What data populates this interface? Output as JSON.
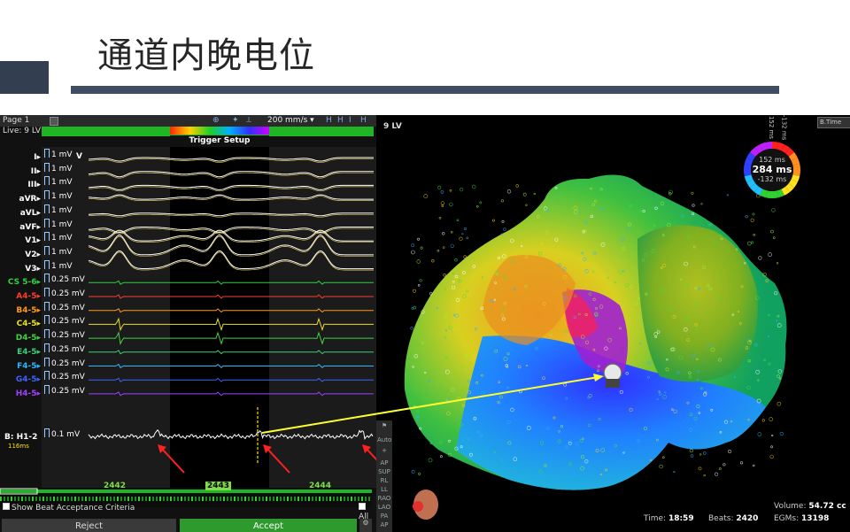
{
  "slide": {
    "title": "通道内晚电位"
  },
  "ep": {
    "page": "Page 1",
    "live": "Live: 9 LV",
    "speed": "200 mm/s",
    "trigger": "Trigger Setup",
    "leads": [
      {
        "name": "I",
        "scale": "1 mV",
        "color": "#ffffff"
      },
      {
        "name": "II",
        "scale": "1 mV",
        "color": "#ffffff"
      },
      {
        "name": "III",
        "scale": "1 mV",
        "color": "#ffffff"
      },
      {
        "name": "aVR",
        "scale": "1 mV",
        "color": "#ffffff"
      },
      {
        "name": "aVL",
        "scale": "1 mV",
        "color": "#ffffff"
      },
      {
        "name": "aVF",
        "scale": "1 mV",
        "color": "#ffffff"
      },
      {
        "name": "V1",
        "scale": "1 mV",
        "color": "#ffffff"
      },
      {
        "name": "V2",
        "scale": "1 mV",
        "color": "#ffffff"
      },
      {
        "name": "V3",
        "scale": "1 mV",
        "color": "#ffffff"
      },
      {
        "name": "CS 5-6",
        "scale": "0.25 mV",
        "color": "#32d040"
      },
      {
        "name": "A4-5",
        "scale": "0.25 mV",
        "color": "#ff3b30"
      },
      {
        "name": "B4-5",
        "scale": "0.25 mV",
        "color": "#ff9a1a"
      },
      {
        "name": "C4-5",
        "scale": "0.25 mV",
        "color": "#e8e020"
      },
      {
        "name": "D4-5",
        "scale": "0.25 mV",
        "color": "#46d046"
      },
      {
        "name": "E4-5",
        "scale": "0.25 mV",
        "color": "#3ad07a"
      },
      {
        "name": "F4-5",
        "scale": "0.25 mV",
        "color": "#2ab8ff"
      },
      {
        "name": "G4-5",
        "scale": "0.25 mV",
        "color": "#3a64ff"
      },
      {
        "name": "H4-5",
        "scale": "0.25 mV",
        "color": "#a040ff"
      }
    ],
    "v_label": "V",
    "bh_label": "B: H1-2",
    "bh_ms": "116",
    "bh_ms_unit": "ms",
    "bh_scale": "0.1 mV",
    "beats": [
      "2442",
      "2443",
      "2444"
    ],
    "show_beat": "Show Beat Acceptance Criteria",
    "all": "All",
    "reject": "Reject",
    "accept": "Accept"
  },
  "map": {
    "label": "9 LV",
    "dropdown": "B.Time",
    "ring_top": "152 ms",
    "ring_top2": "-132 ms",
    "ring_a": "152 ms",
    "ring_b": "284 ms",
    "ring_c": "-132 ms",
    "side_buttons": [
      "Auto",
      "AP",
      "SUP",
      "RL",
      "LL",
      "RAO",
      "LAO",
      "PA",
      "AP"
    ],
    "volume_label": "Volume:",
    "volume": "54.72 cc",
    "time_label": "Time:",
    "time": "18:59",
    "beats_label": "Beats:",
    "beats": "2420",
    "egms_label": "EGMs:",
    "egms": "13198"
  },
  "colors": {
    "title_bar": "#3f4c62",
    "accent_green": "#1fb524"
  }
}
